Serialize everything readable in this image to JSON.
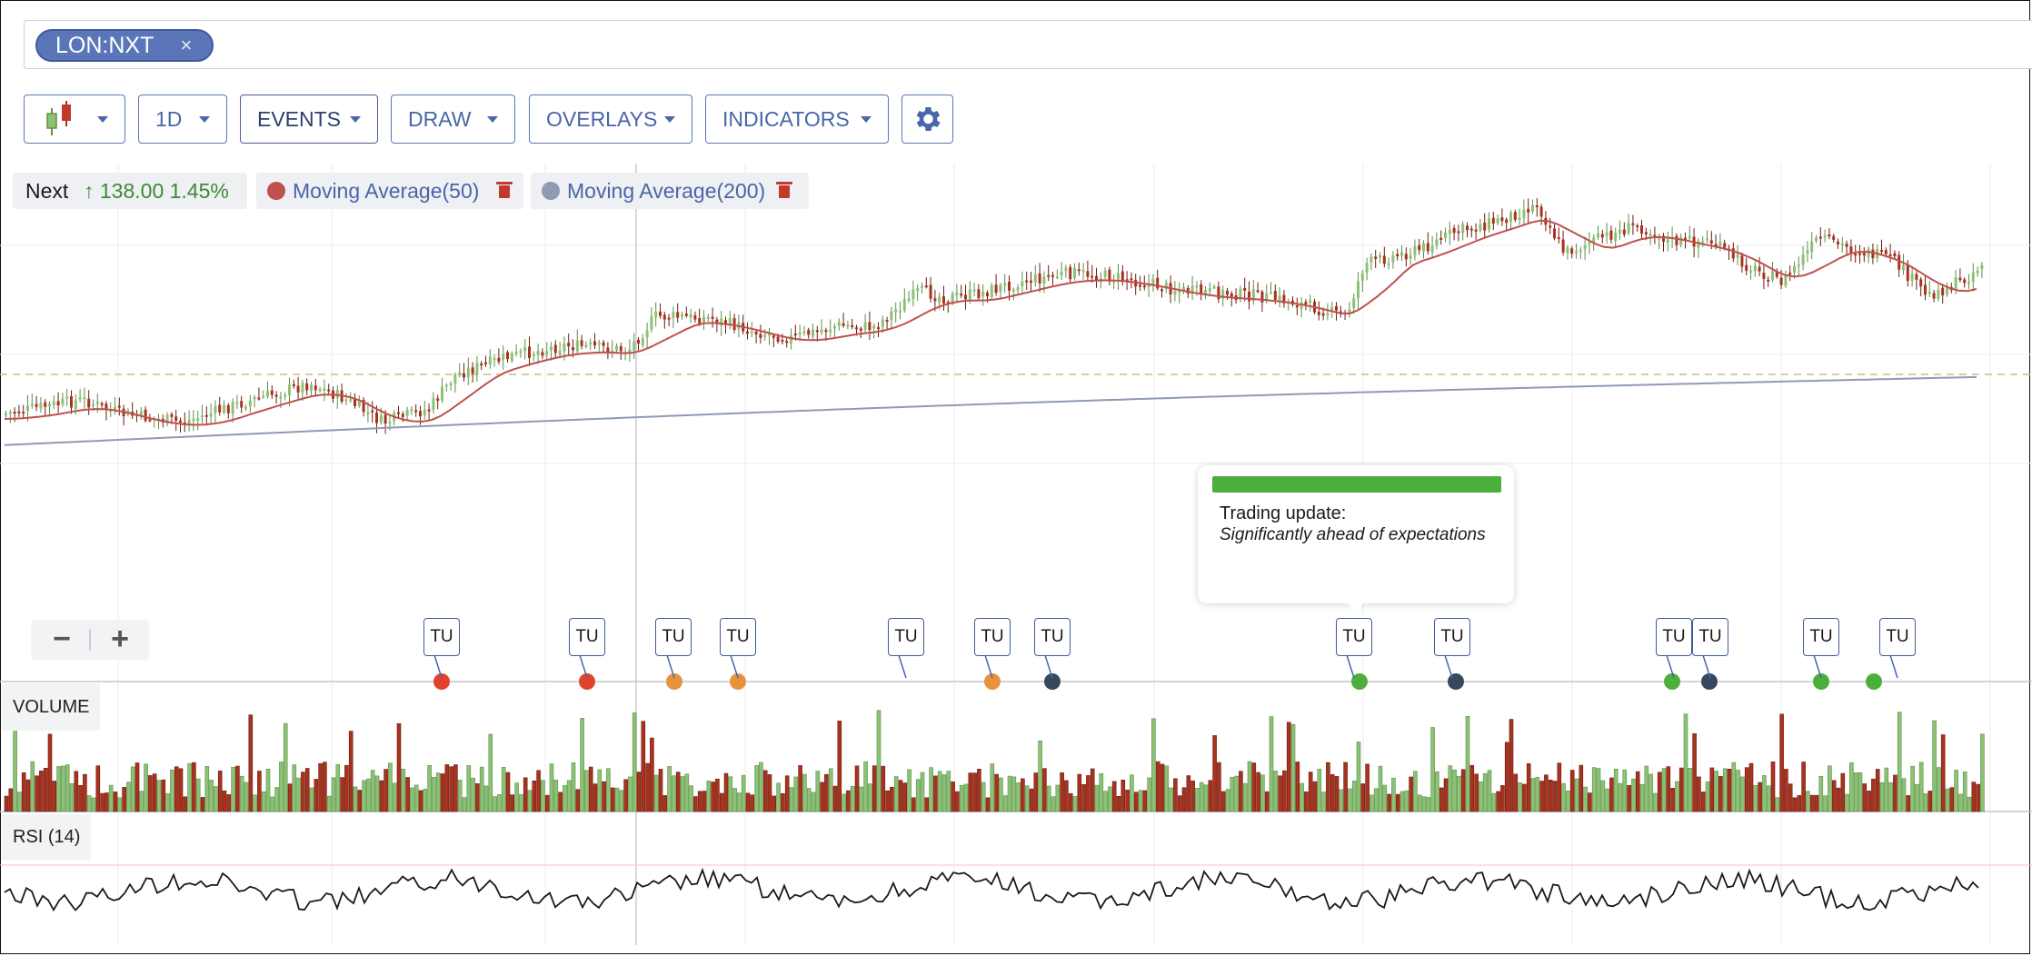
{
  "search": {
    "symbol": "LON:NXT",
    "close_glyph": "×"
  },
  "toolbar": {
    "chart_type_icon": "candlestick-icon",
    "interval": "1D",
    "events": "EVENTS",
    "draw": "DRAW",
    "overlays": "OVERLAYS",
    "indicators": "INDICATORS",
    "settings_icon": "gear-icon"
  },
  "legend": {
    "name": "Next",
    "change": "↑ 138.00  1.45%",
    "ma50": {
      "label": "Moving Average(50)",
      "color": "#c0504d"
    },
    "ma200": {
      "label": "Moving Average(200)",
      "color": "#8e9bb3"
    }
  },
  "zoom": {
    "out": "−",
    "in": "+"
  },
  "events": {
    "tag": "TU",
    "tooltip_title": "Trading update:",
    "tooltip_body": "Significantly ahead of expectations",
    "tooltip_color": "#4caf3c"
  },
  "panes": {
    "volume": "VOLUME",
    "rsi": "RSI (14)"
  },
  "colors": {
    "up": "#8bc276",
    "down": "#a9321f",
    "event_red": "#e0432b",
    "event_orange": "#e6923e",
    "event_dark": "#34495e",
    "event_green": "#4caf3c",
    "accent": "#5a76b8"
  },
  "chart_data": {
    "type": "candlestick",
    "series": [
      {
        "name": "Next"
      },
      {
        "name": "Moving Average(50)"
      },
      {
        "name": "Moving Average(200)"
      }
    ],
    "last_change": 138.0,
    "last_change_pct": 1.45,
    "y_axis_labels": "not shown",
    "x_axis_labels": "not shown",
    "panes": [
      "VOLUME",
      "RSI (14)"
    ]
  }
}
